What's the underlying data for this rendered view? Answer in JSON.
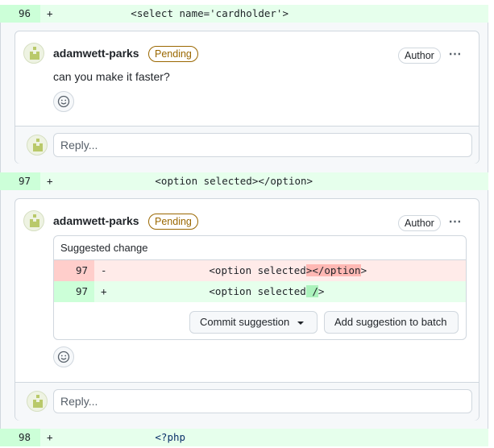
{
  "lines": [
    {
      "num": "96",
      "sign": "+",
      "code": "            <select name='cardholder'>"
    },
    {
      "num": "97",
      "sign": "+",
      "code": "                <option selected></option>"
    },
    {
      "num": "98",
      "sign": "+",
      "code": "                <?php"
    }
  ],
  "thread1": {
    "username": "adamwett-parks",
    "badge": "Pending",
    "role": "Author",
    "menu": "⋯",
    "body": "can you make it faster?",
    "reply_placeholder": "Reply..."
  },
  "thread2": {
    "username": "adamwett-parks",
    "badge": "Pending",
    "role": "Author",
    "menu": "⋯",
    "suggestion": {
      "title": "Suggested change",
      "del": {
        "num": "97",
        "sign": "-",
        "code_a": "                <option selected",
        "code_hl": "></option",
        "code_b": ">"
      },
      "add": {
        "num": "97",
        "sign": "+",
        "code_a": "                <option selected",
        "code_hl": " /",
        "code_b": ">"
      }
    },
    "commit_label": "Commit suggestion",
    "batch_label": "Add suggestion to batch",
    "reply_placeholder": "Reply..."
  },
  "colors": {
    "added": "#e6ffec",
    "removed": "#ffebe9",
    "pending": "#9a6700"
  },
  "icons": {
    "emoji": "smiley-icon",
    "avatar": "identicon-avatar"
  }
}
